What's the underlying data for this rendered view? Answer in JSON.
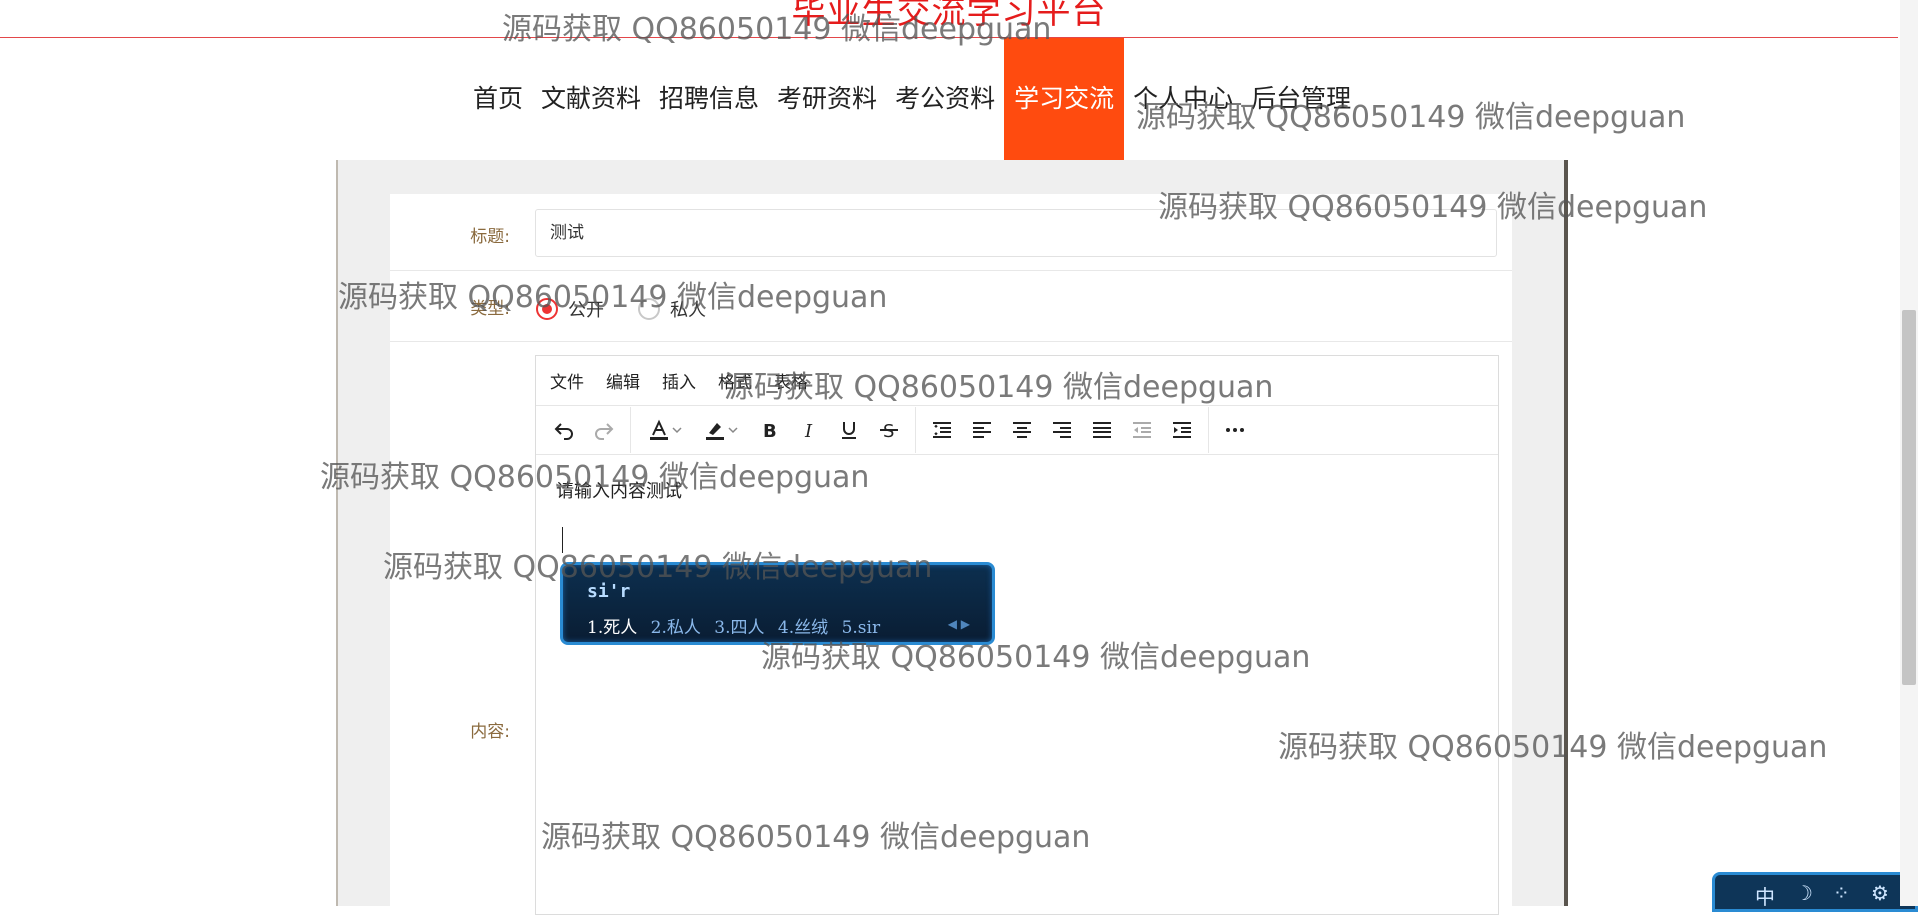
{
  "header": {
    "site_title": "毕业生交流学习平台",
    "nav": [
      {
        "label": "首页"
      },
      {
        "label": "文献资料"
      },
      {
        "label": "招聘信息"
      },
      {
        "label": "考研资料"
      },
      {
        "label": "考公资料"
      },
      {
        "label": "学习交流",
        "active": true
      },
      {
        "label": "个人中心"
      },
      {
        "label": "后台管理"
      }
    ]
  },
  "form": {
    "title_label": "标题:",
    "title_value": "测试",
    "type_label": "类型:",
    "type_options": [
      {
        "label": "公开",
        "checked": true
      },
      {
        "label": "私人",
        "checked": false
      }
    ],
    "content_label": "内容:"
  },
  "editor": {
    "menu": [
      "文件",
      "编辑",
      "插入",
      "格式",
      "表格"
    ],
    "toolbar_icons": [
      "undo-icon",
      "redo-icon",
      "text-color-icon",
      "highlight-icon",
      "bold-icon",
      "italic-icon",
      "underline-icon",
      "strikethrough-icon",
      "line-height-icon",
      "align-left-icon",
      "align-center-icon",
      "align-right-icon",
      "align-justify-icon",
      "outdent-icon",
      "indent-icon",
      "more-icon"
    ],
    "content_text": "请输入内容测试"
  },
  "ime": {
    "input": "si'r",
    "candidates": [
      "1.死人",
      "2.私人",
      "3.四人",
      "4.丝绒",
      "5.sir"
    ],
    "status_bar": [
      "中",
      "☽",
      "⁘",
      "⚙"
    ]
  },
  "watermark": {
    "text": "源码获取 QQ86050149 微信deepguan"
  },
  "colors": {
    "accent": "#ff4b0f",
    "title_red": "#e51c1c",
    "label_brown": "#8a6a3e",
    "radio_red": "#e33333"
  }
}
